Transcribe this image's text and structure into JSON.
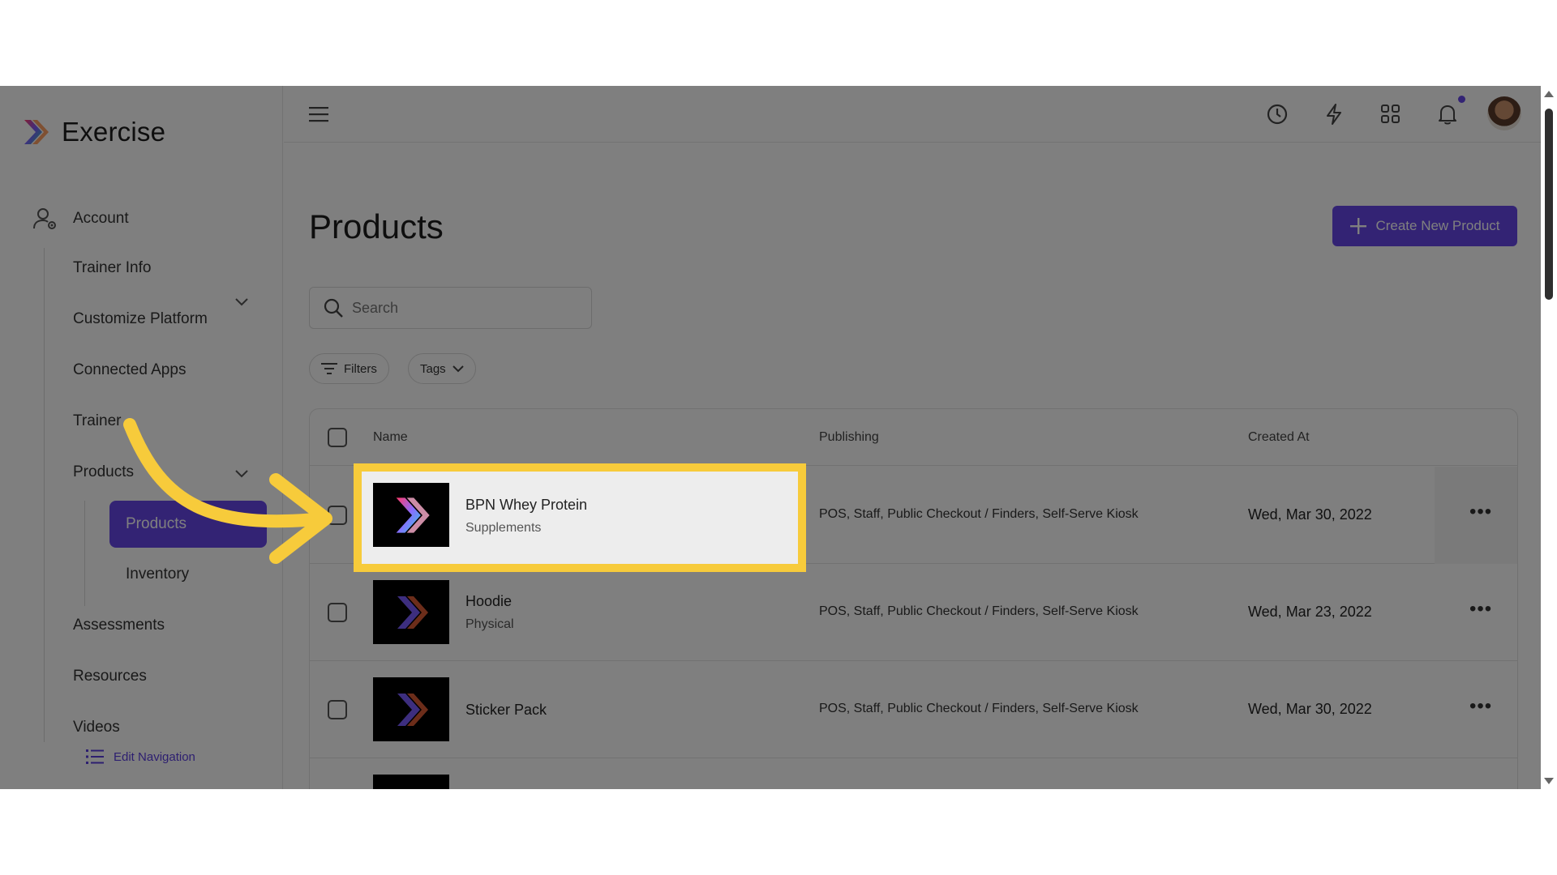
{
  "app": {
    "name": "Exercise"
  },
  "sidebar": {
    "account_label": "Account",
    "account_items": [
      "Trainer Info",
      "Customize Platform",
      "Connected Apps",
      "Trainer"
    ],
    "products_label": "Products",
    "products_sub": [
      "Products",
      "Inventory"
    ],
    "other_items": [
      "Assessments",
      "Resources",
      "Videos"
    ],
    "edit_nav": "Edit Navigation"
  },
  "main": {
    "title": "Products",
    "create_button": "Create New Product",
    "search_placeholder": "Search",
    "filters_label": "Filters",
    "tags_label": "Tags",
    "table": {
      "columns": [
        "Name",
        "Publishing",
        "Created At"
      ],
      "rows": [
        {
          "name": "BPN Whey Protein",
          "category": "Supplements",
          "publishing": "POS, Staff, Public Checkout / Finders, Self-Serve Kiosk",
          "created": "Wed, Mar 30, 2022"
        },
        {
          "name": "Hoodie",
          "category": "Physical",
          "publishing": "POS, Staff, Public Checkout / Finders, Self-Serve Kiosk",
          "created": "Wed, Mar 23, 2022"
        },
        {
          "name": "Sticker Pack",
          "category": "",
          "publishing": "POS, Staff, Public Checkout / Finders, Self-Serve Kiosk",
          "created": "Wed, Mar 30, 2022"
        }
      ]
    },
    "more_glyph": "•••"
  },
  "colors": {
    "accent": "#6647e8",
    "highlight": "#f7cb3b",
    "arrow": "#f7cb3b"
  },
  "icons": [
    "menu-icon",
    "history-icon",
    "lightning-icon",
    "apps-grid-icon",
    "bell-icon",
    "search-icon",
    "filter-icon",
    "chevron-down-icon",
    "plus-icon",
    "list-icon",
    "user-gear-icon"
  ]
}
